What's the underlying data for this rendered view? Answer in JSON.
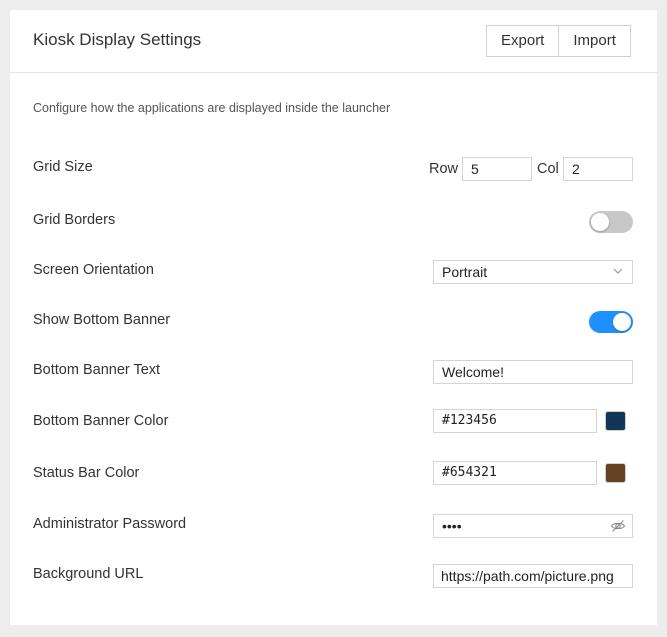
{
  "header": {
    "title": "Kiosk Display Settings",
    "export_label": "Export",
    "import_label": "Import"
  },
  "description": "Configure how the applications are displayed inside the launcher",
  "grid_size": {
    "label": "Grid Size",
    "row_label": "Row",
    "row_value": "5",
    "col_label": "Col",
    "col_value": "2"
  },
  "grid_borders": {
    "label": "Grid Borders",
    "enabled": false
  },
  "screen_orientation": {
    "label": "Screen Orientation",
    "value": "Portrait"
  },
  "show_bottom_banner": {
    "label": "Show Bottom Banner",
    "enabled": true
  },
  "bottom_banner_text": {
    "label": "Bottom Banner Text",
    "value": "Welcome!"
  },
  "bottom_banner_color": {
    "label": "Bottom Banner Color",
    "value": "#123456",
    "swatch": "#123456"
  },
  "status_bar_color": {
    "label": "Status Bar Color",
    "value": "#654321",
    "swatch": "#654321"
  },
  "admin_password": {
    "label": "Administrator Password",
    "value": "••••"
  },
  "background_url": {
    "label": "Background URL",
    "value": "https://path.com/picture.png"
  },
  "colors": {
    "toggle_on": "#1e90ff",
    "toggle_off": "#c8c8c8"
  },
  "icons": {
    "select_arrow": "chevron-down-icon",
    "password_visibility": "eye-slash-icon"
  }
}
